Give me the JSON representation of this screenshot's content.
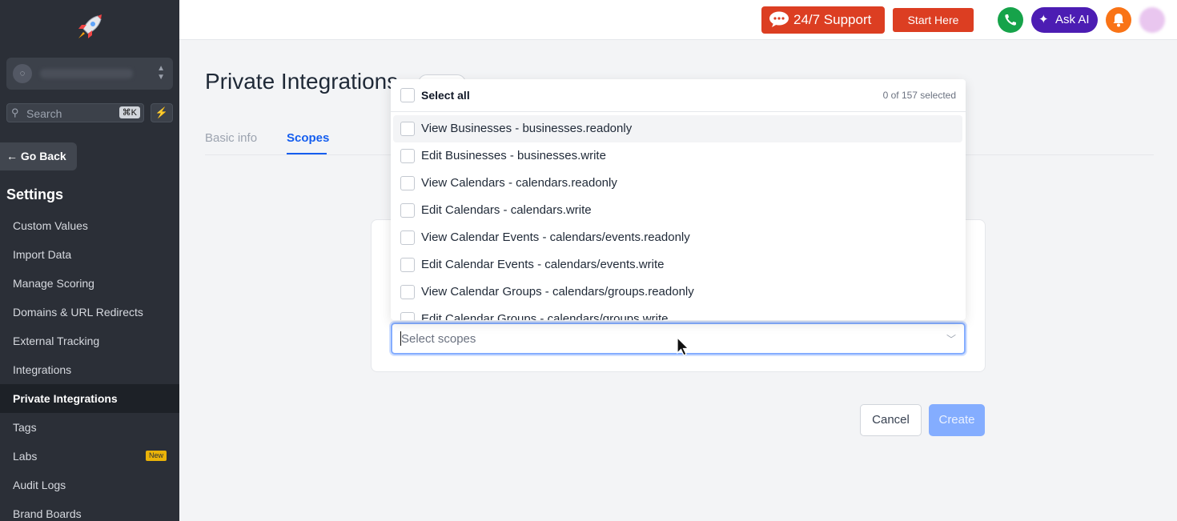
{
  "sidebar": {
    "search_placeholder": "Search",
    "search_shortcut": "⌘K",
    "go_back_label": "← Go Back",
    "section_title": "Settings",
    "items": [
      {
        "label": "Custom Values",
        "active": false
      },
      {
        "label": "Import Data",
        "active": false
      },
      {
        "label": "Manage Scoring",
        "active": false
      },
      {
        "label": "Domains & URL Redirects",
        "active": false
      },
      {
        "label": "External Tracking",
        "active": false
      },
      {
        "label": "Integrations",
        "active": false
      },
      {
        "label": "Private Integrations",
        "active": true
      },
      {
        "label": "Tags",
        "active": false
      },
      {
        "label": "Labs",
        "active": false,
        "badge": "New"
      },
      {
        "label": "Audit Logs",
        "active": false
      },
      {
        "label": "Brand Boards",
        "active": false
      }
    ]
  },
  "topbar": {
    "support_label": "24/7 Support",
    "start_here_label": "Start Here",
    "ask_ai_label": "Ask AI",
    "icons": [
      "chat-icon",
      "phone-icon",
      "sparkle-icon",
      "bell-icon"
    ]
  },
  "main": {
    "title": "Private Integrations",
    "tabs": [
      {
        "label": "Basic info",
        "active": false
      },
      {
        "label": "Scopes",
        "active": true
      }
    ],
    "scope_select": {
      "placeholder": "Select scopes",
      "select_all_label": "Select all",
      "selected_count": "0 of 157 selected",
      "options": [
        "View Businesses - businesses.readonly",
        "Edit Businesses - businesses.write",
        "View Calendars - calendars.readonly",
        "Edit Calendars - calendars.write",
        "View Calendar Events - calendars/events.readonly",
        "Edit Calendar Events - calendars/events.write",
        "View Calendar Groups - calendars/groups.readonly",
        "Edit Calendar Groups - calendars/groups.write"
      ]
    },
    "cancel_label": "Cancel",
    "create_label": "Create"
  },
  "colors": {
    "sidebar_bg": "#2b2f37",
    "accent": "#155eef",
    "support_red": "#dc3e22",
    "ask_ai_purple": "#4c1db3",
    "phone_green": "#16a34a",
    "bell_orange": "#f97316"
  }
}
